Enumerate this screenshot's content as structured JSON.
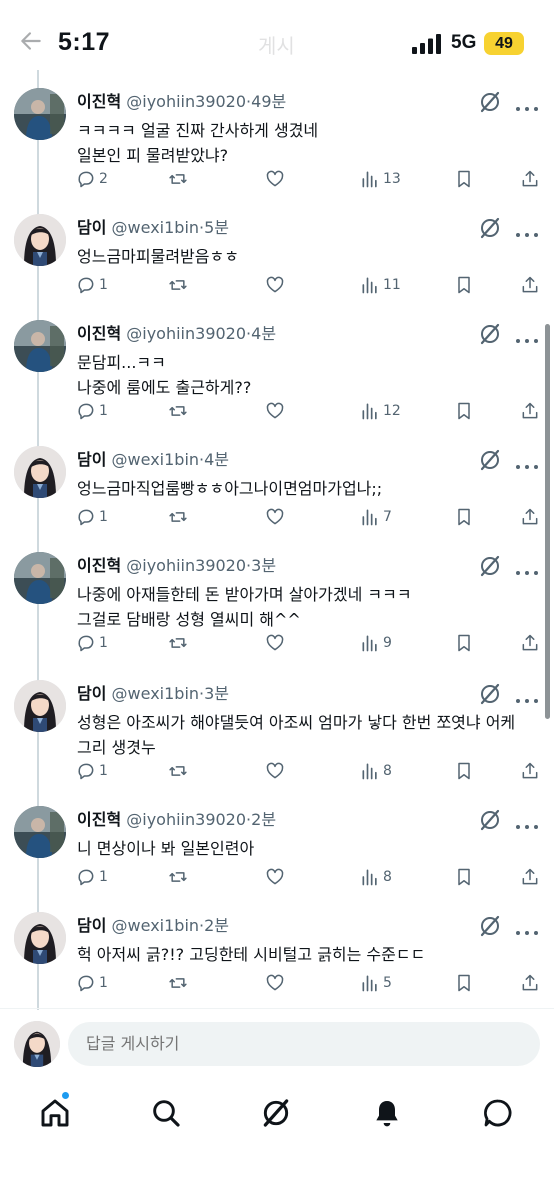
{
  "status_bar": {
    "time": "5:17",
    "network": "5G",
    "battery": "49",
    "battery_color": "#f7d231"
  },
  "header": {
    "back_icon": "arrow-left-icon",
    "title": "게시"
  },
  "replies": [
    {
      "name": "이진혁",
      "handle": "@iyohiin39020",
      "sep": "·",
      "time": "49분",
      "avatar": "photo-avatar-blue",
      "lines": [
        "ㅋㅋㅋㅋ 얼굴 진짜 간사하게 생겼네",
        "일본인 피 물려받았냐?"
      ],
      "replies": "2",
      "reposts": "",
      "likes": "",
      "views": "13"
    },
    {
      "name": "담이",
      "handle": "@wexi1bin",
      "sep": "·",
      "time": "5분",
      "avatar": "anime-avatar",
      "lines": [
        "엉느금마피물려받음ㅎㅎ"
      ],
      "replies": "1",
      "reposts": "",
      "likes": "",
      "views": "11"
    },
    {
      "name": "이진혁",
      "handle": "@iyohiin39020",
      "sep": "·",
      "time": "4분",
      "avatar": "photo-avatar-blue",
      "lines": [
        "문담피...ㅋㅋ",
        "나중에 룸에도 출근하게??"
      ],
      "replies": "1",
      "reposts": "",
      "likes": "",
      "views": "12"
    },
    {
      "name": "담이",
      "handle": "@wexi1bin",
      "sep": "·",
      "time": "4분",
      "avatar": "anime-avatar",
      "lines": [
        "엉느금마직업룸빵ㅎㅎ아그나이면엄마가업나;;"
      ],
      "replies": "1",
      "reposts": "",
      "likes": "",
      "views": "7"
    },
    {
      "name": "이진혁",
      "handle": "@iyohiin39020",
      "sep": "·",
      "time": "3분",
      "avatar": "photo-avatar-blue",
      "lines": [
        "나중에 아재들한테 돈 받아가며 살아가겠네 ㅋㅋㅋ",
        "그걸로 담배랑 성형 열씨미 해^^"
      ],
      "replies": "1",
      "reposts": "",
      "likes": "",
      "views": "9"
    },
    {
      "name": "담이",
      "handle": "@wexi1bin",
      "sep": "·",
      "time": "3분",
      "avatar": "anime-avatar",
      "lines": [
        "성형은 아조씨가 해야댈듯여 아조씨 엄마가 낳다 한번 쪼엿냐 어케",
        "그리 생겻누"
      ],
      "replies": "1",
      "reposts": "",
      "likes": "",
      "views": "8"
    },
    {
      "name": "이진혁",
      "handle": "@iyohiin39020",
      "sep": "·",
      "time": "2분",
      "avatar": "photo-avatar-blue",
      "lines": [
        "니 면상이나 봐 일본인련아"
      ],
      "replies": "1",
      "reposts": "",
      "likes": "",
      "views": "8"
    },
    {
      "name": "담이",
      "handle": "@wexi1bin",
      "sep": "·",
      "time": "2분",
      "avatar": "anime-avatar",
      "lines": [
        "헉 아저씨 긁?!? 고딩한테 시비털고 긁히는 수준ㄷㄷ"
      ],
      "replies": "1",
      "reposts": "",
      "likes": "",
      "views": "5"
    }
  ],
  "composer": {
    "placeholder": "답글 게시하기",
    "avatar": "anime-avatar"
  },
  "bottom_nav": {
    "items": [
      "home-icon",
      "search-icon",
      "grok-icon",
      "notifications-icon",
      "messages-icon"
    ],
    "notification_dot_color": "#1d9bf0"
  }
}
